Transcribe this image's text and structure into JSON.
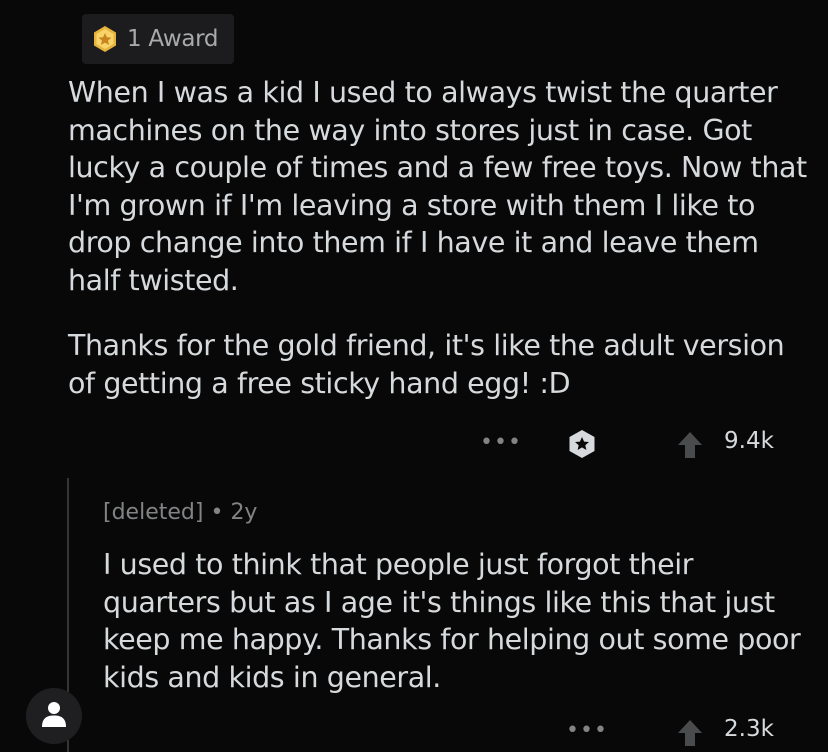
{
  "award": {
    "icon": "award-star-icon",
    "label": "1 Award"
  },
  "comment": {
    "paragraphs": [
      "When I was a kid I used to always twist the quarter machines on the way into stores just in case. Got lucky a couple of times and a few free toys. Now that I'm grown if I'm leaving a store with them I like to drop change into them if I have it and leave them half twisted.",
      "Thanks for the gold friend, it's like the adult version of getting a free sticky hand egg! :D"
    ],
    "more_label": "•••",
    "score": "9.4k"
  },
  "reply": {
    "author": "[deleted]",
    "separator": "•",
    "age": "2y",
    "text": "I used to think that people just forgot their quarters but as I age it's things like this that just keep me happy. Thanks for helping out some poor kids and kids in general.",
    "more_label": "•••",
    "score": "2.3k"
  },
  "colors": {
    "background": "#080809",
    "text": "#d7dadc",
    "muted": "#818384",
    "award_gold": "#e8b33a"
  }
}
